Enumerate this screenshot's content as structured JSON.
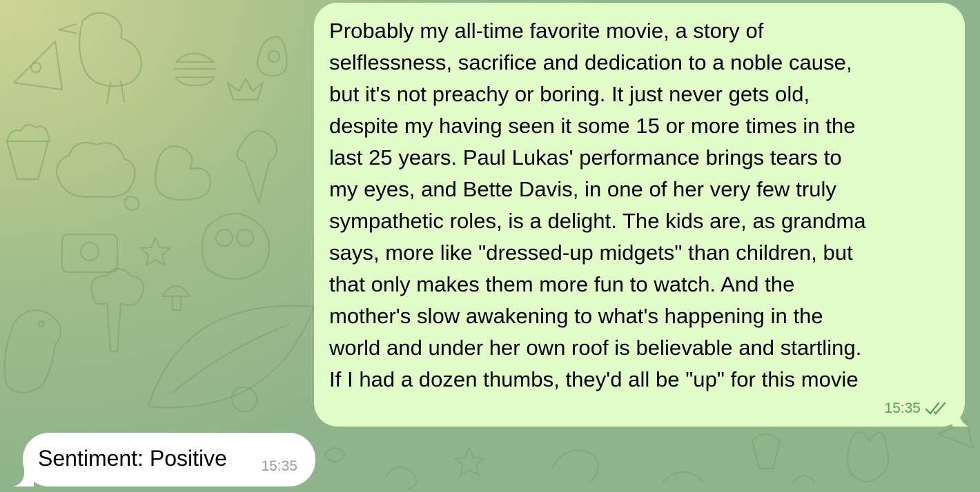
{
  "chat": {
    "outgoing": {
      "lines": [
        "Probably my all-time favorite movie, a story of",
        "selflessness, sacrifice and dedication to a noble cause,",
        "but it's not preachy or boring. It just never gets old,",
        "despite my having seen it some 15 or more times in the",
        "last 25 years. Paul Lukas' performance brings tears to",
        "my eyes, and Bette Davis, in one of her very few truly",
        "sympathetic roles, is a delight. The kids are, as grandma",
        "says, more like \"dressed-up midgets\" than children, but",
        "that only makes them more fun to watch. And the",
        "mother's slow awakening to what's happening in the",
        "world and under her own roof is believable and startling.",
        "If I had a dozen thumbs, they'd all be \"up\" for this movie"
      ],
      "time": "15:35",
      "status_icon": "double-check-icon"
    },
    "incoming": {
      "text": "Sentiment: Positive",
      "time": "15:35"
    }
  },
  "colors": {
    "outgoing_bubble": "#e1fbc9",
    "incoming_bubble": "#ffffff",
    "outgoing_meta": "#55a44d",
    "incoming_meta": "#9a9a9a"
  }
}
